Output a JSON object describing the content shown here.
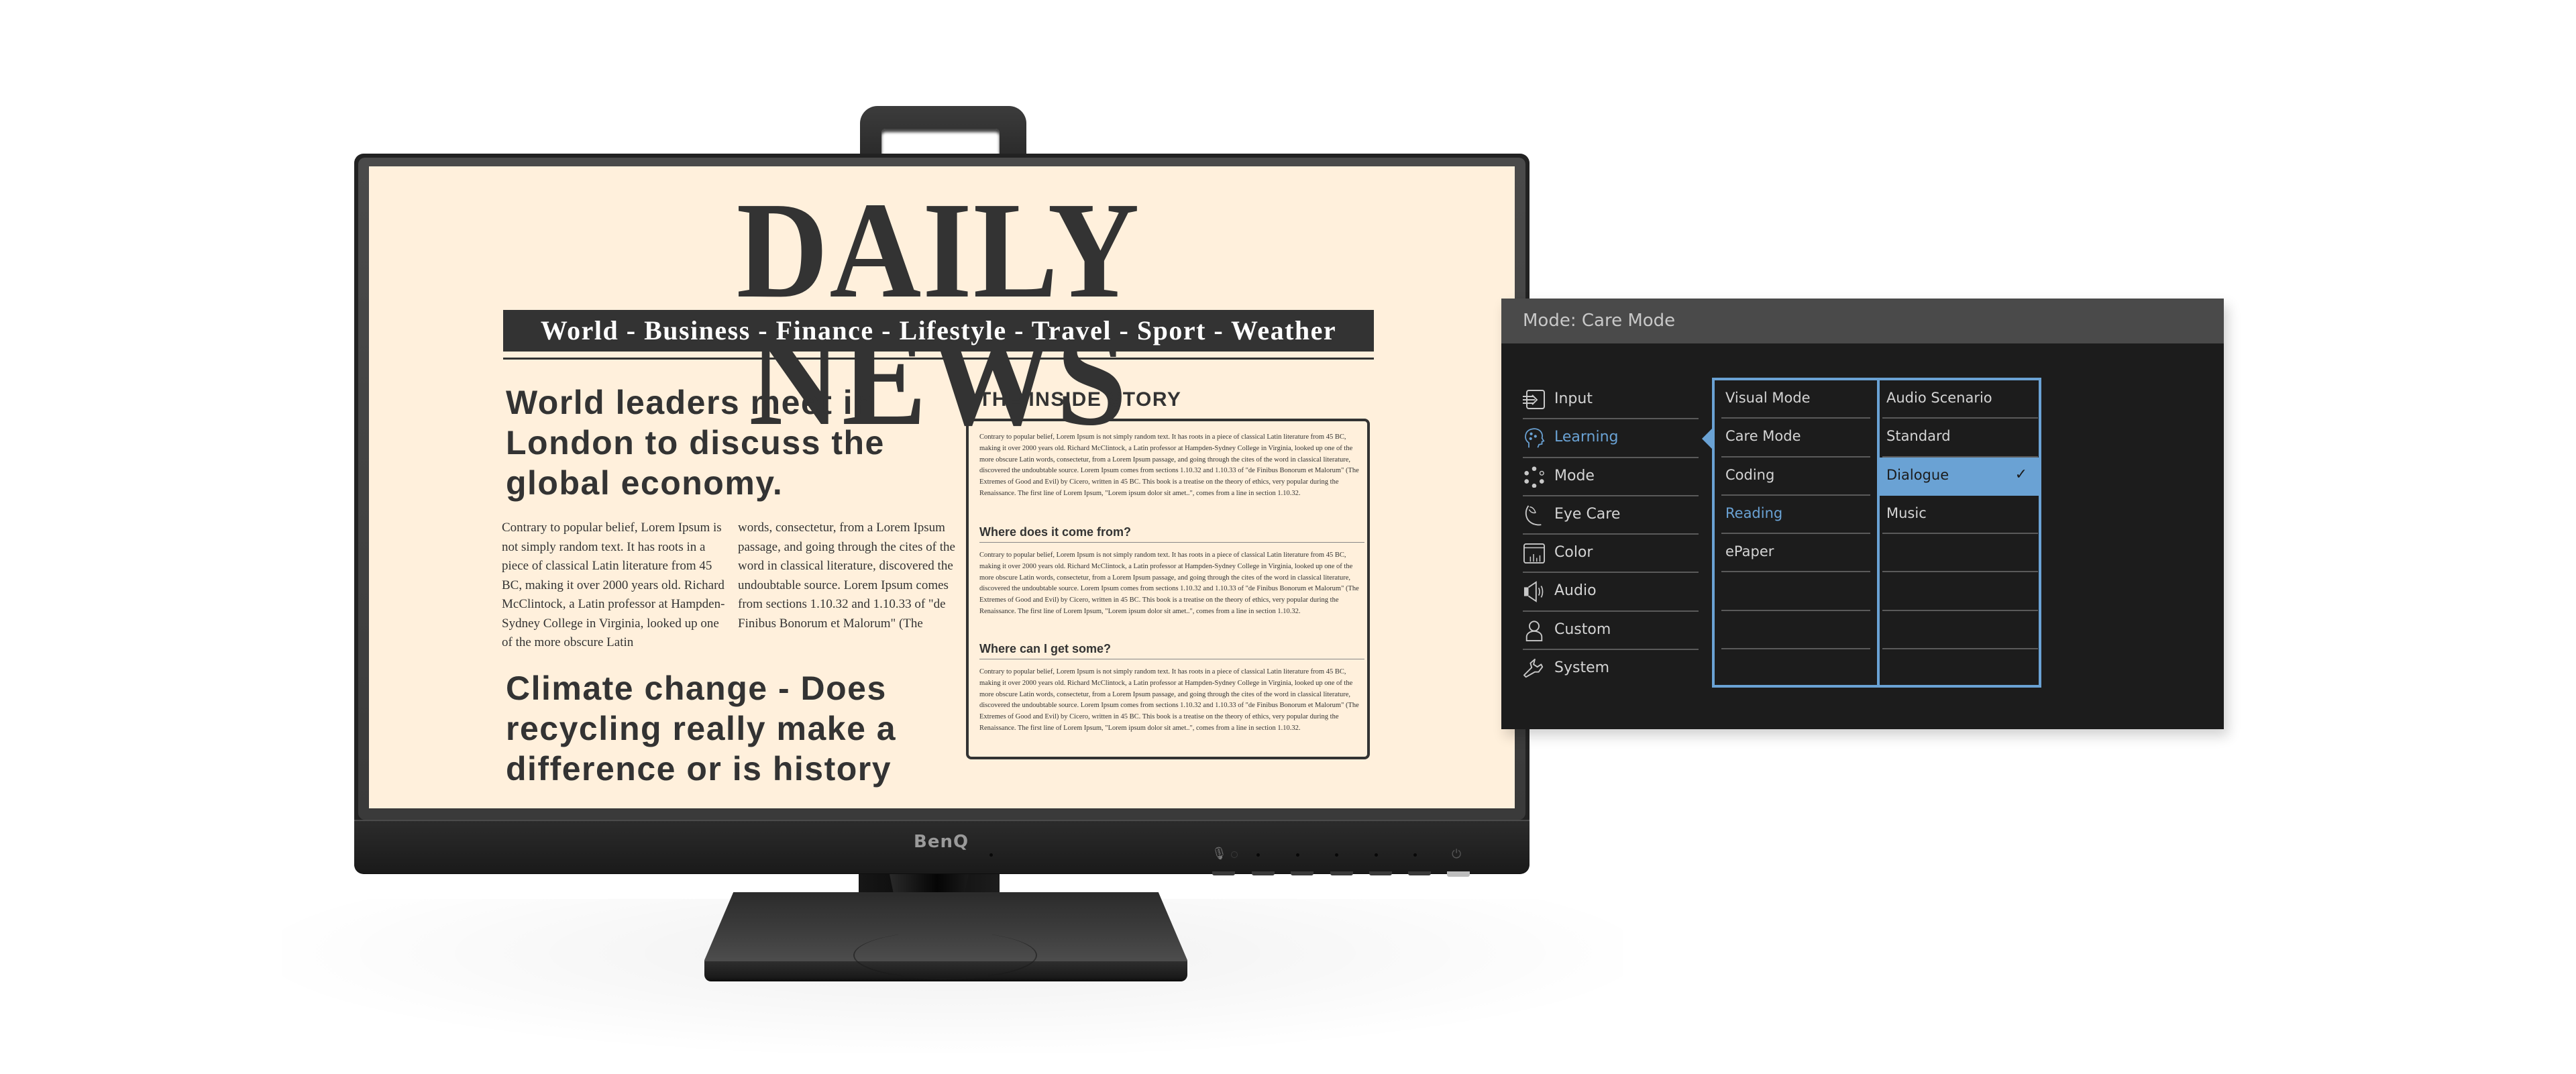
{
  "monitor": {
    "brand_logo": "BenQ",
    "control_icons": [
      "microphone-icon",
      "power-icon"
    ]
  },
  "newspaper": {
    "masthead": "DAILY NEWS",
    "sections": "World - Business - Finance - Lifestyle - Travel - Sport - Weather",
    "headline_1": "World leaders meet in London to discuss the global economy.",
    "article_col_1": "Contrary to popular belief, Lorem Ipsum is not simply random text. It has roots in a piece of classical Latin literature from 45 BC, making it over 2000 years old. Richard McClintock, a Latin professor at Hampden-Sydney College in Virginia, looked up one of the more obscure Latin",
    "article_col_2": "words, consectetur, from a Lorem Ipsum passage, and going through the cites of  the word in classical literature, discovered the undoubtable source. Lorem Ipsum comes from sections 1.10.32 and 1.10.33 of \"de Finibus Bonorum et Malorum\" (The",
    "headline_2": "Climate change - Does recycling really make a difference or is history",
    "inside_story": {
      "title": "THE INSIDE STORY",
      "intro": "Contrary to popular belief, Lorem Ipsum is not simply random text. It has roots in a piece of classical Latin literature from 45 BC, making it over 2000 years old. Richard McClintock, a Latin professor at Hampden-Sydney College in Virginia, looked up one of the more obscure Latin words, consectetur, from a Lorem Ipsum passage, and going through the cites of  the word in classical literature, discovered the undoubtable source. Lorem Ipsum comes from sections 1.10.32 and 1.10.33 of \"de Finibus Bonorum et Malorum\" (The Extremes of Good and Evil) by Cicero, written in 45 BC. This book is a treatise on the theory of ethics, very popular during the Renaissance. The first line of Lorem Ipsum, \"Lorem ipsum dolor sit amet..\", comes from a line in section 1.10.32.",
      "subheading_1": "Where does it come from?",
      "paragraph_1": "Contrary to popular belief, Lorem Ipsum is not simply random text. It has roots in a piece of classical Latin literature from 45 BC, making it over 2000 years old. Richard McClintock, a Latin professor at Hampden-Sydney College in Virginia, looked up one of the more obscure Latin words, consectetur, from a Lorem Ipsum passage, and going through the cites of  the word in classical literature, discovered the undoubtable source. Lorem Ipsum comes from sections 1.10.32 and 1.10.33 of \"de Finibus Bonorum et Malorum\" (The Extremes of Good and Evil) by Cicero, written in 45 BC. This book is a treatise on the theory of ethics, very popular during the Renaissance. The first line of Lorem Ipsum, \"Lorem ipsum dolor sit amet..\", comes from a line in section 1.10.32.",
      "subheading_2": "Where can I get some?",
      "paragraph_2": "Contrary to popular belief, Lorem Ipsum is not simply random text. It has roots in a piece of classical Latin literature from 45 BC, making it over 2000 years old. Richard McClintock, a Latin professor at Hampden-Sydney College in Virginia, looked up one of the more obscure Latin words, consectetur, from a Lorem Ipsum passage, and going through the cites of  the word in classical literature, discovered the undoubtable source. Lorem Ipsum comes from sections 1.10.32 and 1.10.33 of \"de Finibus Bonorum et Malorum\" (The Extremes of Good and Evil) by Cicero, written in 45 BC. This book is a treatise on the theory of ethics, very popular during the Renaissance. The first line of Lorem Ipsum, \"Lorem ipsum dolor sit amet..\", comes from a line in section 1.10.32."
    }
  },
  "osd": {
    "title": "Mode: Care Mode",
    "accent_color": "#6aa2d4",
    "main_menu": [
      {
        "label": "Input",
        "icon": "input-icon"
      },
      {
        "label": "Learning",
        "icon": "learning-head-icon",
        "active": true
      },
      {
        "label": "Mode",
        "icon": "mode-dots-icon"
      },
      {
        "label": "Eye Care",
        "icon": "eye-care-icon"
      },
      {
        "label": "Color",
        "icon": "color-chart-icon"
      },
      {
        "label": "Audio",
        "icon": "speaker-icon"
      },
      {
        "label": "Custom",
        "icon": "user-icon"
      },
      {
        "label": "System",
        "icon": "wrench-icon"
      }
    ],
    "submenu": [
      {
        "label": "Visual Mode"
      },
      {
        "label": "Care Mode"
      },
      {
        "label": "Coding"
      },
      {
        "label": "Reading",
        "current": true
      },
      {
        "label": "ePaper"
      },
      {
        "label": ""
      },
      {
        "label": ""
      },
      {
        "label": ""
      }
    ],
    "options": [
      {
        "label": "Audio Scenario"
      },
      {
        "label": "Standard"
      },
      {
        "label": "Dialogue",
        "selected": true,
        "check_icon": "✓"
      },
      {
        "label": "Music"
      },
      {
        "label": ""
      },
      {
        "label": ""
      },
      {
        "label": ""
      },
      {
        "label": ""
      }
    ]
  }
}
